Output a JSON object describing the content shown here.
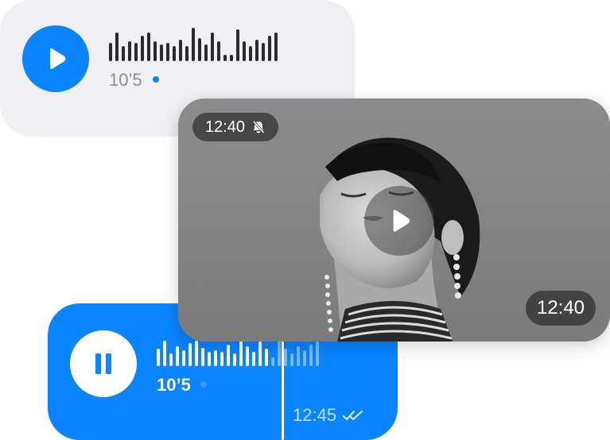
{
  "voice_message_gray": {
    "duration": "10’5",
    "unread": true,
    "waveform": [
      0.55,
      0.85,
      0.45,
      0.6,
      0.55,
      0.75,
      0.85,
      0.6,
      0.5,
      0.55,
      0.45,
      0.65,
      0.45,
      1.0,
      0.7,
      0.5,
      0.85,
      0.6,
      0.2,
      0.2,
      0.95,
      0.6,
      0.45,
      0.65,
      0.55,
      0.75,
      0.85
    ]
  },
  "video_message": {
    "top_time": "12:40",
    "bottom_time": "12:40",
    "top_icon": "bell-off-icon",
    "center_icon": "play-icon"
  },
  "voice_message_blue": {
    "duration": "10’5",
    "time": "12:45",
    "status_icon": "double-check-icon",
    "waveform": [
      0.6,
      0.9,
      0.45,
      0.7,
      0.55,
      0.8,
      0.9,
      0.65,
      0.5,
      0.55,
      0.5,
      0.75,
      0.45,
      1.0,
      0.7,
      0.5,
      0.85,
      0.6,
      0.3,
      0.95,
      0.6,
      0.45,
      0.7,
      0.55,
      0.75,
      0.85
    ],
    "played_bars": 18
  },
  "colors": {
    "accent": "#0A84FF",
    "gray_bubble": "#EFEFF4",
    "waveform_dark": "#2B2B2B",
    "muted_text": "#8E8E93"
  }
}
